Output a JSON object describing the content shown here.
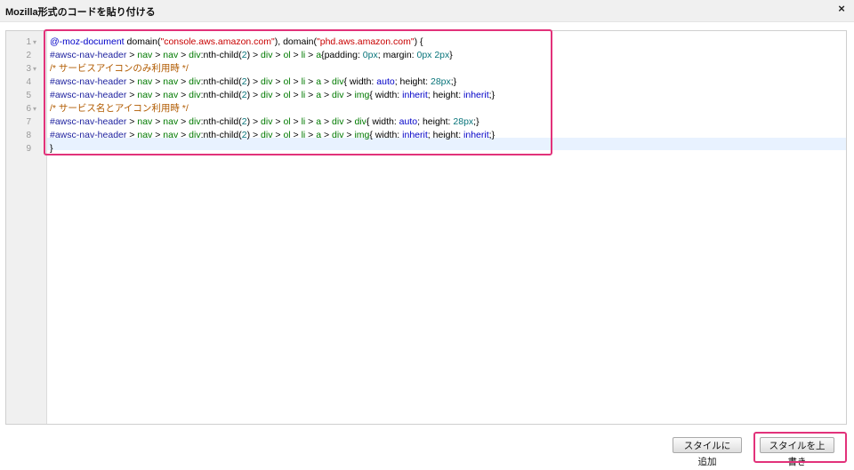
{
  "dialog": {
    "title": "Mozilla形式のコードを貼り付ける",
    "close_label": "×"
  },
  "editor": {
    "line_numbers": [
      "1",
      "2",
      "3",
      "4",
      "5",
      "6",
      "7",
      "8",
      "9"
    ],
    "fold_markers": [
      "1",
      "3",
      "6"
    ],
    "fold_symbol": "▾",
    "lines": [
      [
        {
          "t": "@-moz-document",
          "c": "kw"
        },
        {
          "t": " domain(",
          "c": ""
        },
        {
          "t": "\"console.aws.amazon.com\"",
          "c": "str"
        },
        {
          "t": "), domain(",
          "c": ""
        },
        {
          "t": "\"phd.aws.amazon.com\"",
          "c": "str"
        },
        {
          "t": ") {",
          "c": ""
        }
      ],
      [
        {
          "t": "#awsc-nav-header",
          "c": "sel2"
        },
        {
          "t": " > ",
          "c": ""
        },
        {
          "t": "nav",
          "c": "sel"
        },
        {
          "t": " > ",
          "c": ""
        },
        {
          "t": "nav",
          "c": "sel"
        },
        {
          "t": " > ",
          "c": ""
        },
        {
          "t": "div",
          "c": "sel"
        },
        {
          "t": ":nth-child(",
          "c": ""
        },
        {
          "t": "2",
          "c": "num"
        },
        {
          "t": ") > ",
          "c": ""
        },
        {
          "t": "div",
          "c": "sel"
        },
        {
          "t": " > ",
          "c": ""
        },
        {
          "t": "ol",
          "c": "sel"
        },
        {
          "t": " > ",
          "c": ""
        },
        {
          "t": "li",
          "c": "sel"
        },
        {
          "t": " > ",
          "c": ""
        },
        {
          "t": "a",
          "c": "sel"
        },
        {
          "t": "{padding: ",
          "c": ""
        },
        {
          "t": "0px",
          "c": "num"
        },
        {
          "t": "; margin: ",
          "c": ""
        },
        {
          "t": "0px 2px",
          "c": "num"
        },
        {
          "t": "}",
          "c": ""
        }
      ],
      [
        {
          "t": "/* サービスアイコンのみ利用時 */",
          "c": "cm"
        }
      ],
      [
        {
          "t": "#awsc-nav-header",
          "c": "sel2"
        },
        {
          "t": " > ",
          "c": ""
        },
        {
          "t": "nav",
          "c": "sel"
        },
        {
          "t": " > ",
          "c": ""
        },
        {
          "t": "nav",
          "c": "sel"
        },
        {
          "t": " > ",
          "c": ""
        },
        {
          "t": "div",
          "c": "sel"
        },
        {
          "t": ":nth-child(",
          "c": ""
        },
        {
          "t": "2",
          "c": "num"
        },
        {
          "t": ") > ",
          "c": ""
        },
        {
          "t": "div",
          "c": "sel"
        },
        {
          "t": " > ",
          "c": ""
        },
        {
          "t": "ol",
          "c": "sel"
        },
        {
          "t": " > ",
          "c": ""
        },
        {
          "t": "li",
          "c": "sel"
        },
        {
          "t": " > ",
          "c": ""
        },
        {
          "t": "a",
          "c": "sel"
        },
        {
          "t": " > ",
          "c": ""
        },
        {
          "t": "div",
          "c": "sel"
        },
        {
          "t": "{ width: ",
          "c": ""
        },
        {
          "t": "auto",
          "c": "kw"
        },
        {
          "t": "; height: ",
          "c": ""
        },
        {
          "t": "28px",
          "c": "num"
        },
        {
          "t": ";}",
          "c": ""
        }
      ],
      [
        {
          "t": "#awsc-nav-header",
          "c": "sel2"
        },
        {
          "t": " > ",
          "c": ""
        },
        {
          "t": "nav",
          "c": "sel"
        },
        {
          "t": " > ",
          "c": ""
        },
        {
          "t": "nav",
          "c": "sel"
        },
        {
          "t": " > ",
          "c": ""
        },
        {
          "t": "div",
          "c": "sel"
        },
        {
          "t": ":nth-child(",
          "c": ""
        },
        {
          "t": "2",
          "c": "num"
        },
        {
          "t": ") > ",
          "c": ""
        },
        {
          "t": "div",
          "c": "sel"
        },
        {
          "t": " > ",
          "c": ""
        },
        {
          "t": "ol",
          "c": "sel"
        },
        {
          "t": " > ",
          "c": ""
        },
        {
          "t": "li",
          "c": "sel"
        },
        {
          "t": " > ",
          "c": ""
        },
        {
          "t": "a",
          "c": "sel"
        },
        {
          "t": " > ",
          "c": ""
        },
        {
          "t": "div",
          "c": "sel"
        },
        {
          "t": " > ",
          "c": ""
        },
        {
          "t": "img",
          "c": "sel"
        },
        {
          "t": "{ width: ",
          "c": ""
        },
        {
          "t": "inherit",
          "c": "kw"
        },
        {
          "t": "; height: ",
          "c": ""
        },
        {
          "t": "inherit",
          "c": "kw"
        },
        {
          "t": ";}",
          "c": ""
        }
      ],
      [
        {
          "t": "/* サービス名とアイコン利用時 */",
          "c": "cm"
        }
      ],
      [
        {
          "t": "#awsc-nav-header",
          "c": "sel2"
        },
        {
          "t": " > ",
          "c": ""
        },
        {
          "t": "nav",
          "c": "sel"
        },
        {
          "t": " > ",
          "c": ""
        },
        {
          "t": "nav",
          "c": "sel"
        },
        {
          "t": " > ",
          "c": ""
        },
        {
          "t": "div",
          "c": "sel"
        },
        {
          "t": ":nth-child(",
          "c": ""
        },
        {
          "t": "2",
          "c": "num"
        },
        {
          "t": ") > ",
          "c": ""
        },
        {
          "t": "div",
          "c": "sel"
        },
        {
          "t": " > ",
          "c": ""
        },
        {
          "t": "ol",
          "c": "sel"
        },
        {
          "t": " > ",
          "c": ""
        },
        {
          "t": "li",
          "c": "sel"
        },
        {
          "t": " > ",
          "c": ""
        },
        {
          "t": "a",
          "c": "sel"
        },
        {
          "t": " > ",
          "c": ""
        },
        {
          "t": "div",
          "c": "sel"
        },
        {
          "t": " > ",
          "c": ""
        },
        {
          "t": "div",
          "c": "sel"
        },
        {
          "t": "{ width: ",
          "c": ""
        },
        {
          "t": "auto",
          "c": "kw"
        },
        {
          "t": "; height: ",
          "c": ""
        },
        {
          "t": "28px",
          "c": "num"
        },
        {
          "t": ";}",
          "c": ""
        }
      ],
      [
        {
          "t": "#awsc-nav-header",
          "c": "sel2"
        },
        {
          "t": " > ",
          "c": ""
        },
        {
          "t": "nav",
          "c": "sel"
        },
        {
          "t": " > ",
          "c": ""
        },
        {
          "t": "nav",
          "c": "sel"
        },
        {
          "t": " > ",
          "c": ""
        },
        {
          "t": "div",
          "c": "sel"
        },
        {
          "t": ":nth-child(",
          "c": ""
        },
        {
          "t": "2",
          "c": "num"
        },
        {
          "t": ") > ",
          "c": ""
        },
        {
          "t": "div",
          "c": "sel"
        },
        {
          "t": " > ",
          "c": ""
        },
        {
          "t": "ol",
          "c": "sel"
        },
        {
          "t": " > ",
          "c": ""
        },
        {
          "t": "li",
          "c": "sel"
        },
        {
          "t": " > ",
          "c": ""
        },
        {
          "t": "a",
          "c": "sel"
        },
        {
          "t": " > ",
          "c": ""
        },
        {
          "t": "div",
          "c": "sel"
        },
        {
          "t": " > ",
          "c": ""
        },
        {
          "t": "img",
          "c": "sel"
        },
        {
          "t": "{ width: ",
          "c": ""
        },
        {
          "t": "inherit",
          "c": "kw"
        },
        {
          "t": "; height: ",
          "c": ""
        },
        {
          "t": "inherit",
          "c": "kw"
        },
        {
          "t": ";}",
          "c": ""
        }
      ],
      [
        {
          "t": "}",
          "c": ""
        }
      ]
    ]
  },
  "buttons": {
    "add_style": "スタイルに追加",
    "overwrite_style": "スタイルを上書き"
  },
  "colors": {
    "highlight": "#e2327a",
    "keyword": "#0000c8",
    "string": "#c80000",
    "selector": "#007a00",
    "id_selector": "#1f23a0",
    "number": "#08747a",
    "comment": "#b15b00",
    "active_line": "#e8f2ff"
  }
}
